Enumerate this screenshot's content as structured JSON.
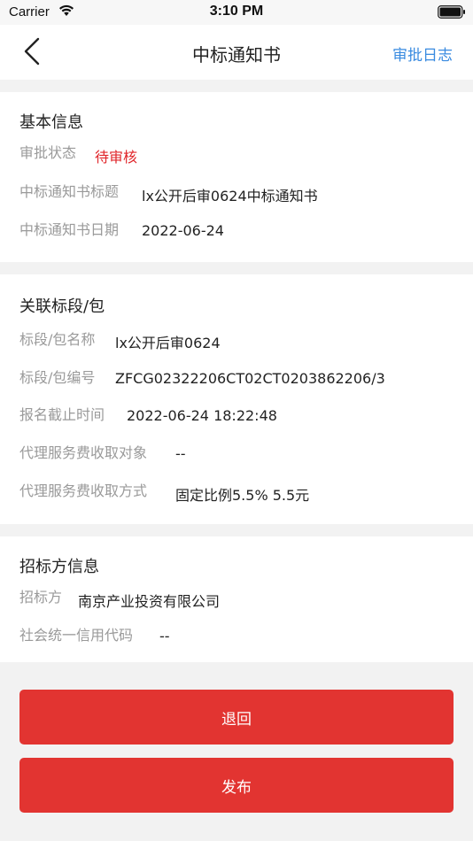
{
  "status_bar": {
    "carrier": "Carrier",
    "time": "3:10 PM"
  },
  "nav": {
    "title": "中标通知书",
    "action": "审批日志",
    "back_icon": "chevron-left-icon"
  },
  "basic_info": {
    "title": "基本信息",
    "rows": [
      {
        "label": "审批状态",
        "value": "待审核"
      },
      {
        "label": "中标通知书标题",
        "value": "lx公开后审0624中标通知书"
      },
      {
        "label": "中标通知书日期",
        "value": "2022-06-24"
      }
    ]
  },
  "section_info": {
    "title": "关联标段/包",
    "rows": [
      {
        "label": "标段/包名称",
        "value": "lx公开后审0624"
      },
      {
        "label": "标段/包编号",
        "value": "ZFCG02322206CT02CT0203862206/3"
      },
      {
        "label": "报名截止时间",
        "value": "2022-06-24 18:22:48"
      },
      {
        "label": "代理服务费收取对象",
        "value": "--"
      },
      {
        "label": "代理服务费收取方式",
        "value": "固定比例5.5% 5.5元"
      }
    ]
  },
  "tenderer_info": {
    "title": "招标方信息",
    "rows": [
      {
        "label": "招标方",
        "value": "南京产业投资有限公司"
      },
      {
        "label": "社会统一信用代码",
        "value": "--"
      }
    ]
  },
  "buttons": {
    "return_label": "退回",
    "publish_label": "发布"
  },
  "colors": {
    "accent_red": "#e23431",
    "status_red": "#e0252a",
    "link_blue": "#3a8be0",
    "label_gray": "#9a9a9a"
  }
}
